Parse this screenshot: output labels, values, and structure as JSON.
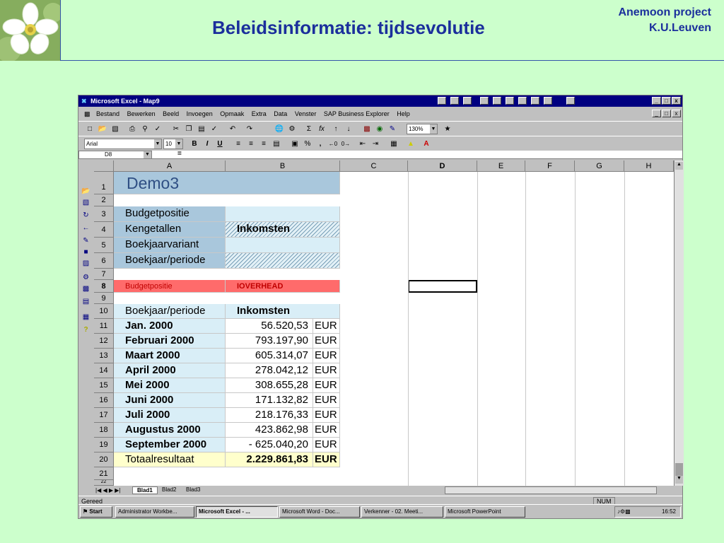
{
  "slide": {
    "title": "Beleidsinformatie: tijdsevolutie",
    "org_line1": "Anemoon project",
    "org_line2": "K.U.Leuven"
  },
  "window": {
    "title": "Microsoft Excel - Map9",
    "controls": [
      "_",
      "□",
      "x"
    ]
  },
  "menu": [
    "Bestand",
    "Bewerken",
    "Beeld",
    "Invoegen",
    "Opmaak",
    "Extra",
    "Data",
    "Venster",
    "SAP Business Explorer",
    "Help"
  ],
  "toolbar": {
    "zoom": "130%",
    "font_name": "Arial",
    "font_size": "10",
    "bold": "B",
    "italic": "I",
    "underline": "U",
    "sigma": "Σ",
    "fx": "fx",
    "percent": "%",
    "comma": ","
  },
  "formula": {
    "name_box": "D8",
    "equals": "="
  },
  "sheet": {
    "columns": [
      "A",
      "B",
      "C",
      "D",
      "E",
      "F",
      "G",
      "H"
    ],
    "rows": [
      "1",
      "2",
      "3",
      "4",
      "5",
      "6",
      "7",
      "8",
      "9",
      "10",
      "11",
      "12",
      "13",
      "14",
      "15",
      "16",
      "17",
      "18",
      "19",
      "20",
      "21",
      "22"
    ],
    "demo_title": "Demo3",
    "filter_labels": [
      "Budgetpositie",
      "Kengetallen",
      "Boekjaarvariant",
      "Boekjaar/periode"
    ],
    "filter_values": [
      "",
      "Inkomsten",
      "",
      ""
    ],
    "budget_label": "Budgetpositie",
    "budget_value": "IOVERHEAD",
    "table_header": [
      "Boekjaar/periode",
      "Inkomsten"
    ],
    "table_rows": [
      {
        "period": "Jan. 2000",
        "value": "56.520,53",
        "unit": "EUR"
      },
      {
        "period": "Februari 2000",
        "value": "793.197,90",
        "unit": "EUR"
      },
      {
        "period": "Maart 2000",
        "value": "605.314,07",
        "unit": "EUR"
      },
      {
        "period": "April 2000",
        "value": "278.042,12",
        "unit": "EUR"
      },
      {
        "period": "Mei 2000",
        "value": "308.655,28",
        "unit": "EUR"
      },
      {
        "period": "Juni 2000",
        "value": "171.132,82",
        "unit": "EUR"
      },
      {
        "period": "Juli 2000",
        "value": "218.176,33",
        "unit": "EUR"
      },
      {
        "period": "Augustus 2000",
        "value": "423.862,98",
        "unit": "EUR"
      },
      {
        "period": "September 2000",
        "value": "- 625.040,20",
        "unit": "EUR"
      }
    ],
    "total": {
      "period": "Totaalresultaat",
      "value": "2.229.861,83",
      "unit": "EUR"
    }
  },
  "tabs": [
    "Blad1",
    "Blad2",
    "Blad3"
  ],
  "status": {
    "ready": "Gereed",
    "num": "NUM"
  },
  "taskbar": {
    "start": "Start",
    "tasks": [
      "Administrator Workbe...",
      "Microsoft Excel - ...",
      "Microsoft Word - Doc...",
      "Verkenner - 02. Meeti...",
      "Microsoft PowerPoint"
    ],
    "clock": "16:52"
  },
  "colors": {
    "slide_bg": "#ccffcc",
    "title_blue": "#1b2f9c",
    "excel_title": "#000080",
    "header_blue": "#a9c7dc",
    "light_blue": "#d9eef7",
    "red_row": "#ff6b6b",
    "total_row": "#ffffcc"
  }
}
